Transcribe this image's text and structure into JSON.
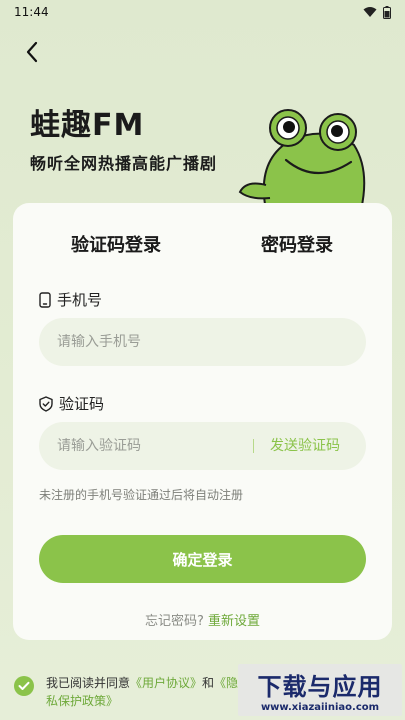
{
  "status_bar": {
    "time": "11:44"
  },
  "brand": {
    "title": "蛙趣FM",
    "slogan": "畅听全网热播高能广播剧"
  },
  "tabs": [
    {
      "label": "验证码登录",
      "active": true
    },
    {
      "label": "密码登录",
      "active": false
    }
  ],
  "phone": {
    "label": "手机号",
    "placeholder": "请输入手机号"
  },
  "code": {
    "label": "验证码",
    "placeholder": "请输入验证码",
    "send_label": "发送验证码"
  },
  "hint": "未注册的手机号验证通过后将自动注册",
  "login_button": "确定登录",
  "forgot": {
    "question": "忘记密码?",
    "reset": "重新设置"
  },
  "agreement": {
    "prefix": "我已阅读并同意",
    "user_agreement": "《用户协议》",
    "and": "和",
    "privacy": "《隐私保护政策》"
  },
  "watermark": {
    "main": "下载与应用",
    "url": "www.xiazaiiniao.com"
  },
  "colors": {
    "accent": "#8bc34a",
    "background": "#e0eacf",
    "card": "#fafbf7"
  },
  "icons": [
    "wifi-icon",
    "battery-icon",
    "back-arrow-icon",
    "phone-icon",
    "shield-icon",
    "check-icon"
  ]
}
